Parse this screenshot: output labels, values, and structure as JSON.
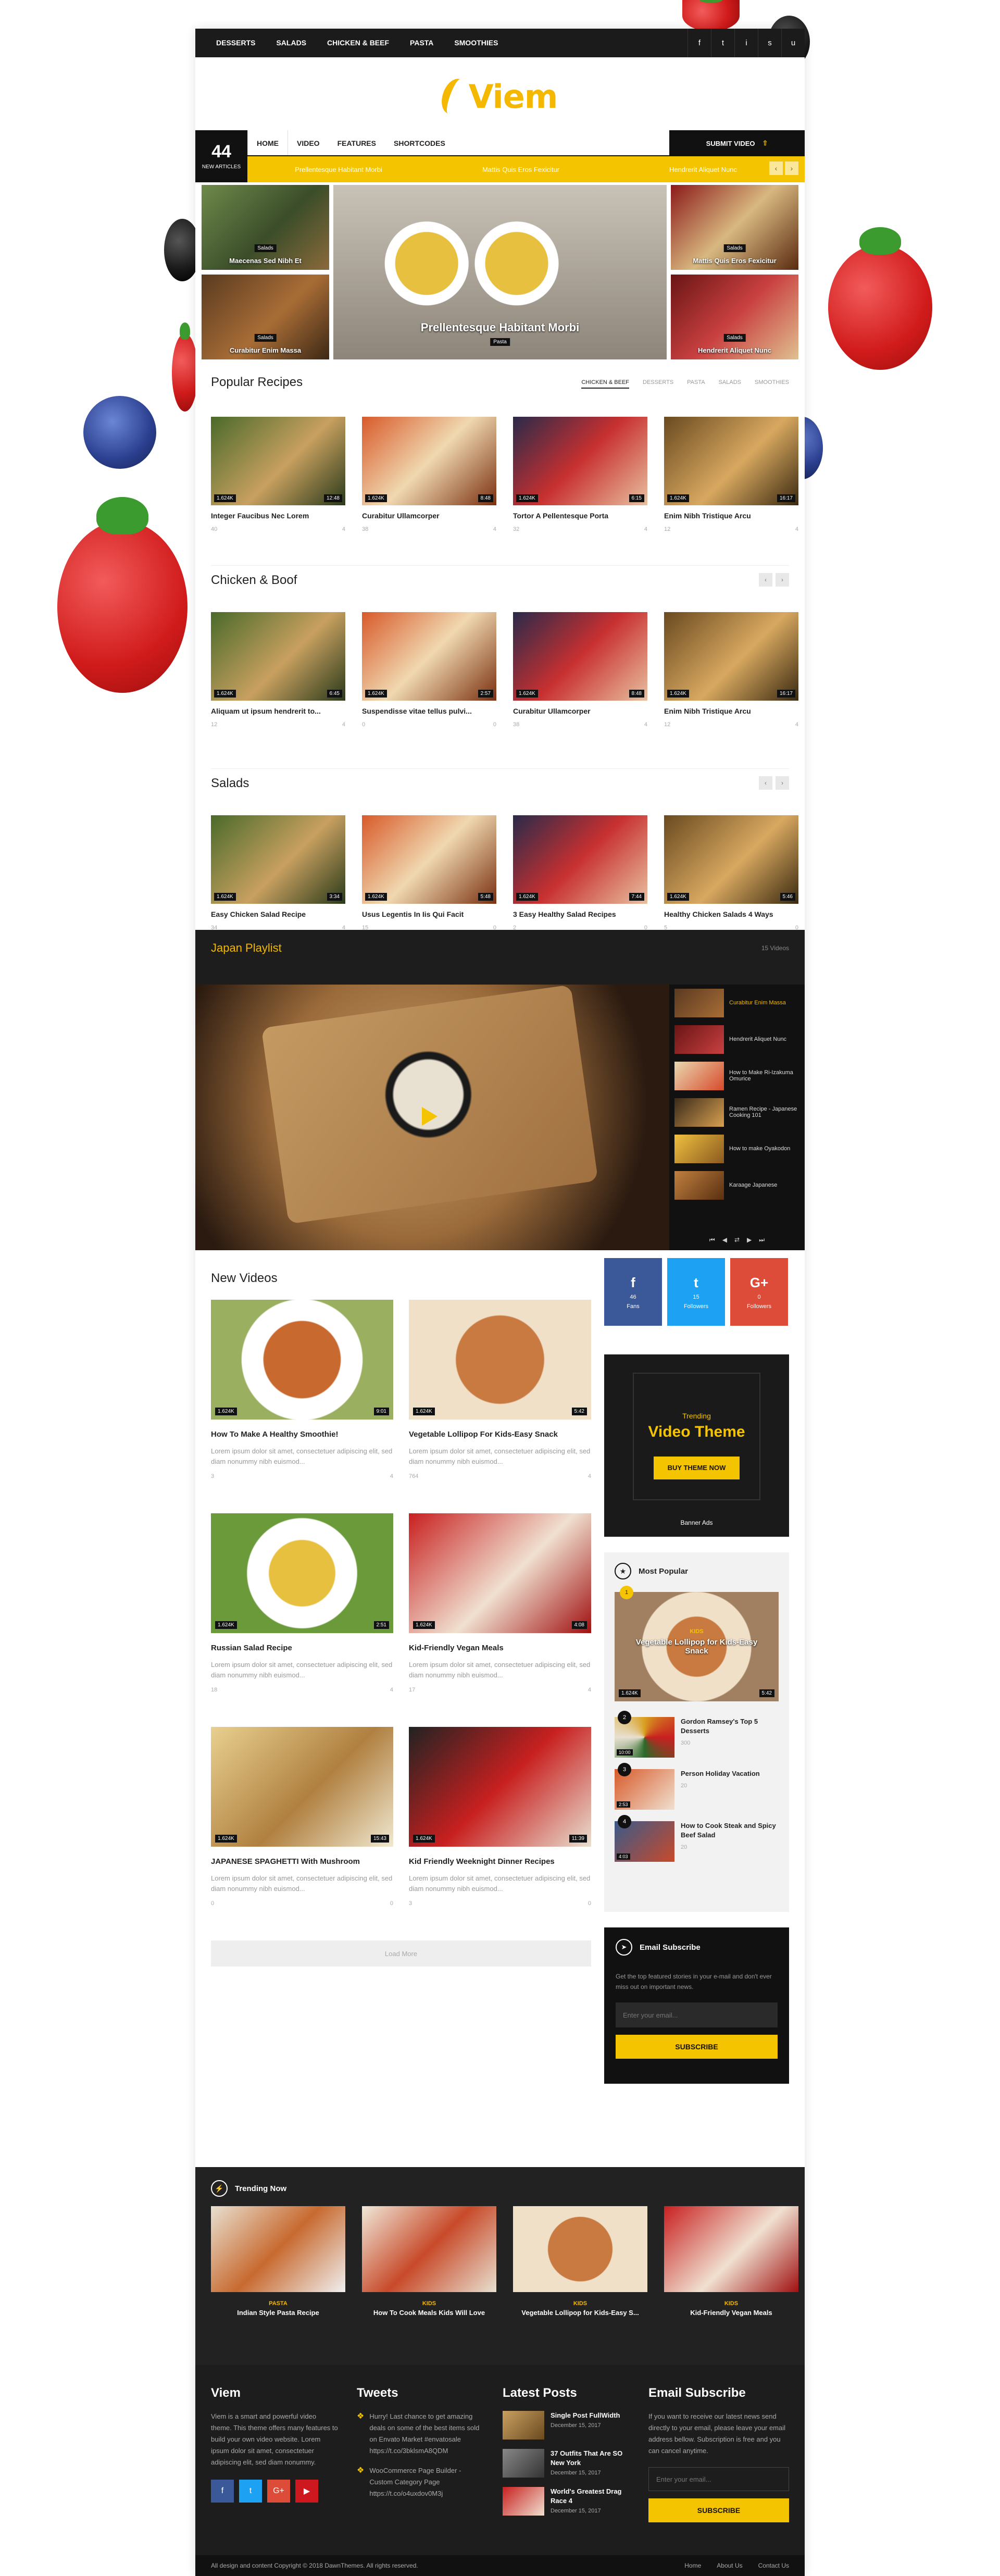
{
  "topbar": {
    "menu": [
      "DESSERTS",
      "SALADS",
      "CHICKEN & BEEF",
      "PASTA",
      "SMOOTHIES"
    ],
    "social": [
      "f",
      "t",
      "i",
      "s",
      "u"
    ]
  },
  "brand": {
    "logo_text": "Viem"
  },
  "counter": {
    "number": "44",
    "label": "NEW ARTICLES"
  },
  "mainnav": {
    "items": [
      "HOME",
      "VIDEO",
      "FEATURES",
      "SHORTCODES"
    ],
    "submit": "SUBMIT VIDEO"
  },
  "ticker": [
    "Prellentesque Habitant Morbi",
    "Mattis Quis Eros Fexicitur",
    "Hendrerit Aliquet Nunc"
  ],
  "hero": {
    "tiles": [
      {
        "cat": "Salads",
        "title": "Maecenas Sed Nibh Et"
      },
      {
        "cat": "Salads",
        "title": "Curabitur Enim Massa"
      },
      {
        "cat": "Pasta",
        "title": "Prellentesque Habitant Morbi"
      },
      {
        "cat": "Salads",
        "title": "Mattis Quis Eros Fexicitur"
      },
      {
        "cat": "Salads",
        "title": "Hendrerit Aliquet Nunc"
      }
    ]
  },
  "popular": {
    "title": "Popular Recipes",
    "tabs": [
      "CHICKEN & BEEF",
      "DESSERTS",
      "PASTA",
      "SALADS",
      "SMOOTHIES"
    ],
    "cards": [
      {
        "title": "Integer Faucibus Nec Lorem",
        "views": "1.624K",
        "dur": "12:48",
        "c1": "40",
        "c2": "4"
      },
      {
        "title": "Curabitur Ullamcorper",
        "views": "1.624K",
        "dur": "8:48",
        "c1": "38",
        "c2": "4"
      },
      {
        "title": "Tortor A Pellentesque Porta",
        "views": "1.624K",
        "dur": "6:15",
        "c1": "32",
        "c2": "4"
      },
      {
        "title": "Enim Nibh Tristique Arcu",
        "views": "1.624K",
        "dur": "16:17",
        "c1": "12",
        "c2": "4"
      }
    ]
  },
  "chicken": {
    "title": "Chicken & Boof",
    "cards": [
      {
        "title": "Aliquam ut ipsum hendrerit to...",
        "views": "1.624K",
        "dur": "6:45",
        "c1": "12",
        "c2": "4"
      },
      {
        "title": "Suspendisse vitae tellus pulvi...",
        "views": "1.624K",
        "dur": "2:57",
        "c1": "0",
        "c2": "0"
      },
      {
        "title": "Curabitur Ullamcorper",
        "views": "1.624K",
        "dur": "8:48",
        "c1": "38",
        "c2": "4"
      },
      {
        "title": "Enim Nibh Tristique Arcu",
        "views": "1.624K",
        "dur": "16:17",
        "c1": "12",
        "c2": "4"
      }
    ]
  },
  "salads": {
    "title": "Salads",
    "cards": [
      {
        "title": "Easy Chicken Salad Recipe",
        "views": "1.624K",
        "dur": "3:34",
        "c1": "34",
        "c2": "4"
      },
      {
        "title": "Usus Legentis In Iis Qui Facit",
        "views": "1.624K",
        "dur": "5:48",
        "c1": "15",
        "c2": "0"
      },
      {
        "title": "3 Easy Healthy Salad Recipes",
        "views": "1.624K",
        "dur": "7:44",
        "c1": "2",
        "c2": "0"
      },
      {
        "title": "Healthy Chicken Salads 4 Ways",
        "views": "1.624K",
        "dur": "5:46",
        "c1": "5",
        "c2": "0"
      }
    ]
  },
  "playlist": {
    "title": "Japan Playlist",
    "count": "15 Videos",
    "items": [
      "Curabitur Enim Massa",
      "Hendrerit Aliquet Nunc",
      "How to Make Ri-Izakuma Omurice",
      "Ramen Recipe - Japanese Cooking 101",
      "How to make Oyakodon",
      "Karaage Japanese"
    ]
  },
  "newvideos": {
    "title": "New Videos",
    "desc": "Lorem ipsum dolor sit amet, consectetuer adipiscing elit, sed diam nonummy nibh euismod...",
    "cards": [
      {
        "title": "How To Make A Healthy Smoothie!",
        "views": "1.624K",
        "dur": "9:01",
        "c1": "3",
        "c2": "4"
      },
      {
        "title": "Vegetable Lollipop For Kids-Easy Snack",
        "views": "1.624K",
        "dur": "5:42",
        "c1": "764",
        "c2": "4"
      },
      {
        "title": "Russian Salad Recipe",
        "views": "1.624K",
        "dur": "2:51",
        "c1": "18",
        "c2": "4"
      },
      {
        "title": "Kid-Friendly Vegan Meals",
        "views": "1.624K",
        "dur": "4:08",
        "c1": "17",
        "c2": "4"
      },
      {
        "title": "JAPANESE SPAGHETTI With Mushroom",
        "views": "1.624K",
        "dur": "15:43",
        "c1": "0",
        "c2": "0"
      },
      {
        "title": "Kid Friendly Weeknight Dinner Recipes",
        "views": "1.624K",
        "dur": "11:39",
        "c1": "3",
        "c2": "0"
      }
    ],
    "loadmore": "Load More"
  },
  "sidebar": {
    "social": [
      {
        "n": "46",
        "l": "Fans"
      },
      {
        "n": "15",
        "l": "Followers"
      },
      {
        "n": "0",
        "l": "Followers"
      }
    ],
    "banner": {
      "kicker": "Trending",
      "title": "Video Theme",
      "button": "BUY THEME NOW",
      "caption": "Banner Ads"
    },
    "popular": {
      "title": "Most Popular",
      "featured": {
        "cat": "KIDS",
        "title": "Vegetable Lollipop for Kids-Easy Snack",
        "views": "1.624K",
        "dur": "5:42"
      },
      "items": [
        {
          "rank": "2",
          "title": "Gordon Ramsey's Top 5 Desserts",
          "meta": "300",
          "dur": "10:00"
        },
        {
          "rank": "3",
          "title": "Person Holiday Vacation",
          "meta": "20",
          "dur": "2:53"
        },
        {
          "rank": "4",
          "title": "How to Cook Steak and Spicy Beef Salad",
          "meta": "20",
          "dur": "4:03"
        }
      ]
    },
    "subscribe": {
      "title": "Email Subscribe",
      "text": "Get the top featured stories in your e-mail and don't ever miss out on important news.",
      "placeholder": "Enter your email...",
      "button": "SUBSCRIBE"
    }
  },
  "trending": {
    "title": "Trending Now",
    "cards": [
      {
        "cat": "PASTA",
        "title": "Indian Style Pasta Recipe"
      },
      {
        "cat": "KIDS",
        "title": "How To Cook Meals Kids Will Love"
      },
      {
        "cat": "KIDS",
        "title": "Vegetable Lollipop for Kids-Easy S..."
      },
      {
        "cat": "KIDS",
        "title": "Kid-Friendly Vegan Meals"
      }
    ]
  },
  "footer": {
    "about": {
      "title": "Viem",
      "text": "Viem is a smart and powerful video theme. This theme offers many features to build your own video website. Lorem ipsum dolor sit amet, consectetuer adipiscing elit, sed diam nonummy."
    },
    "tweets": {
      "title": "Tweets",
      "items": [
        "Hurry! Last chance to get amazing deals on some of the best items sold on Envato Market #envatosale https://t.co/3bklsmA8QDM",
        "WooCommerce Page Builder - Custom Category Page https://t.co/o4uxdov0M3j"
      ]
    },
    "posts": {
      "title": "Latest Posts",
      "items": [
        {
          "t": "Single Post FullWidth",
          "d": "December 15, 2017"
        },
        {
          "t": "37 Outfits That Are SO New York",
          "d": "December 15, 2017"
        },
        {
          "t": "World's Greatest Drag Race 4",
          "d": "December 15, 2017"
        }
      ]
    },
    "subscribe": {
      "title": "Email Subscribe",
      "text": "If you want to receive our latest news send directly to your email, please leave your email address bellow. Subscription is free and you can cancel anytime.",
      "placeholder": "Enter your email...",
      "button": "SUBSCRIBE"
    },
    "copyright": "All design and content Copyright © 2018 DawnThemes. All rights reserved.",
    "links": [
      "Home",
      "About Us",
      "Contact Us"
    ]
  },
  "colors": {
    "accent": "#f5c400",
    "dark": "#1d1d1d",
    "facebook": "#3b5998",
    "twitter": "#1da1f2",
    "google": "#dd4b39",
    "youtube": "#cc181e"
  }
}
